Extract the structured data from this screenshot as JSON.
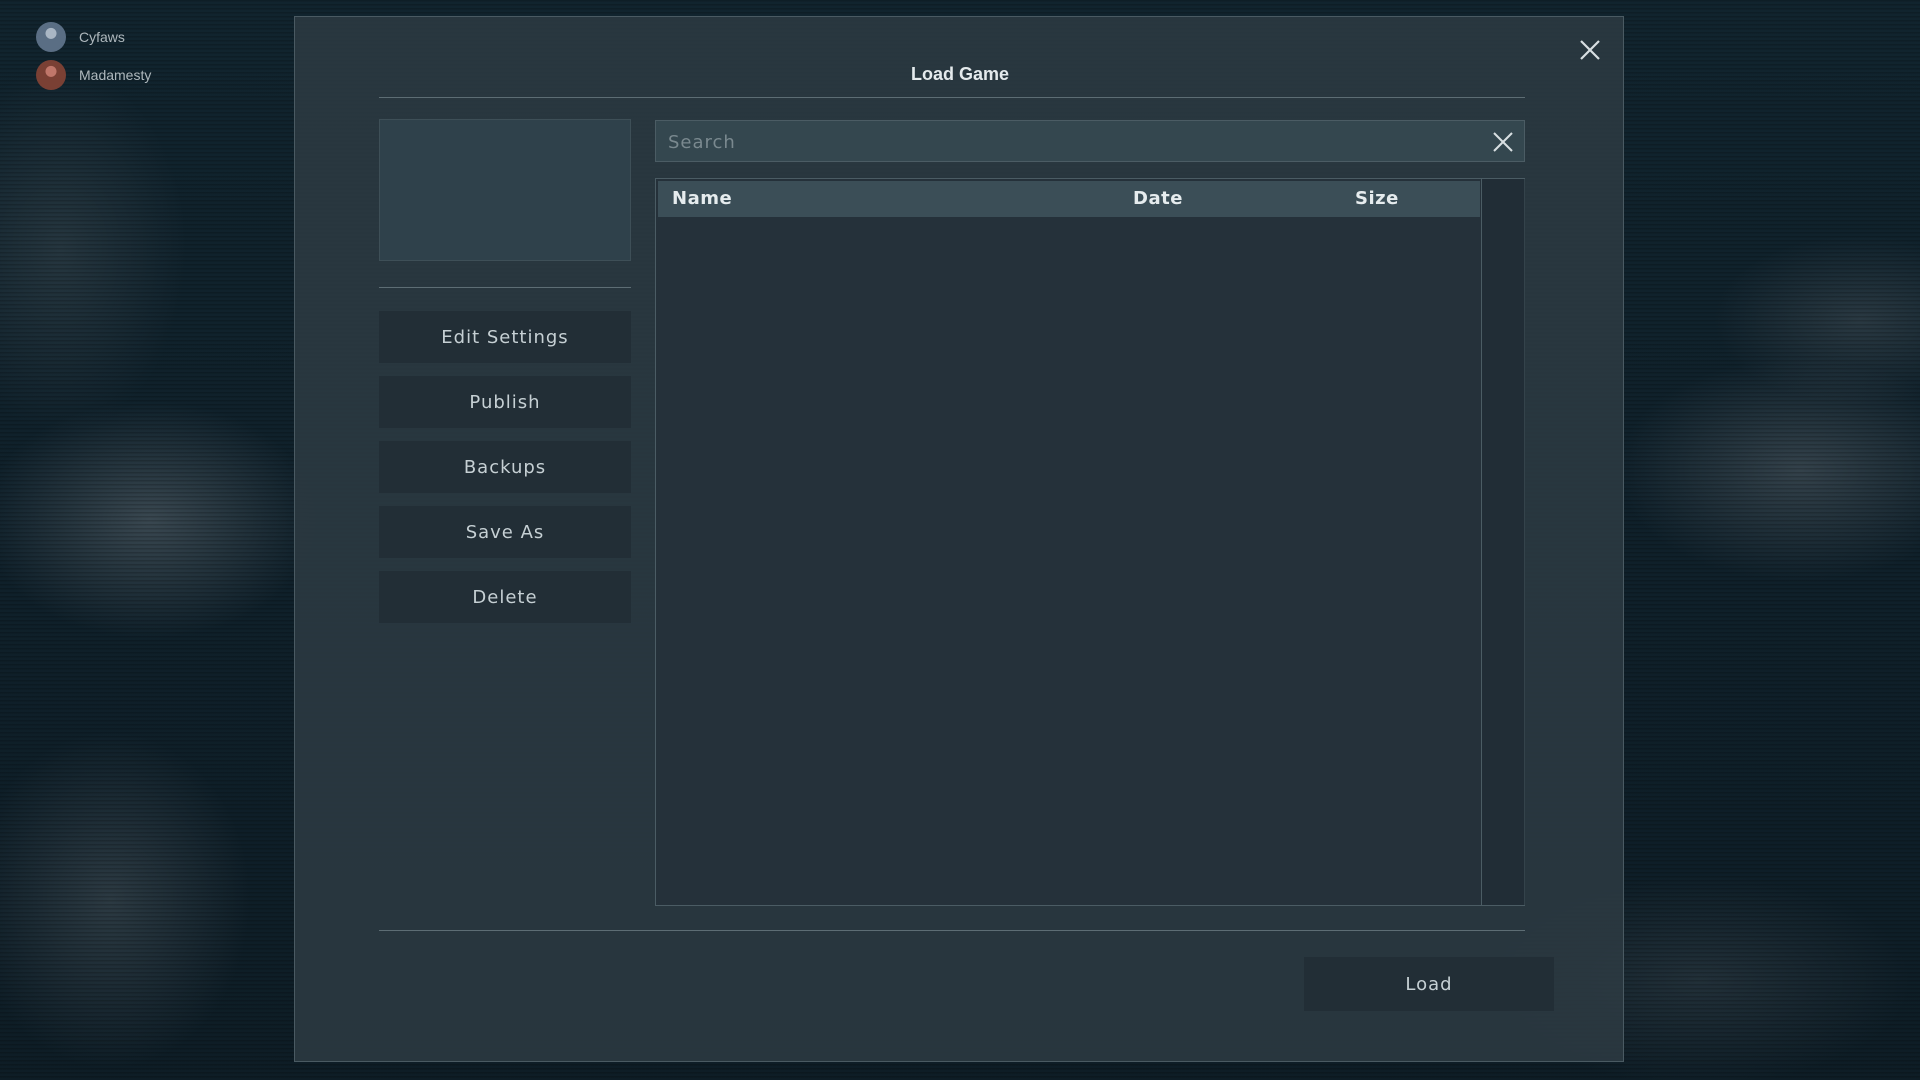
{
  "friends": [
    {
      "name": "Cyfaws",
      "avatar_color": "#5a6e84"
    },
    {
      "name": "Madamesty",
      "avatar_color": "#7a4034"
    }
  ],
  "dialog": {
    "title": "Load Game",
    "close_icon": "close-icon"
  },
  "sidebar": {
    "buttons": [
      {
        "label": "Edit Settings"
      },
      {
        "label": "Publish"
      },
      {
        "label": "Backups"
      },
      {
        "label": "Save As"
      },
      {
        "label": "Delete"
      }
    ]
  },
  "search": {
    "placeholder": "Search",
    "value": "",
    "clear_icon": "close-icon"
  },
  "table": {
    "columns": [
      "Name",
      "Date",
      "Size"
    ],
    "rows": []
  },
  "footer": {
    "load_label": "Load"
  },
  "colors": {
    "background": "#0f202a",
    "dialog": "#2c3a42",
    "text": "#c6d0d4"
  }
}
